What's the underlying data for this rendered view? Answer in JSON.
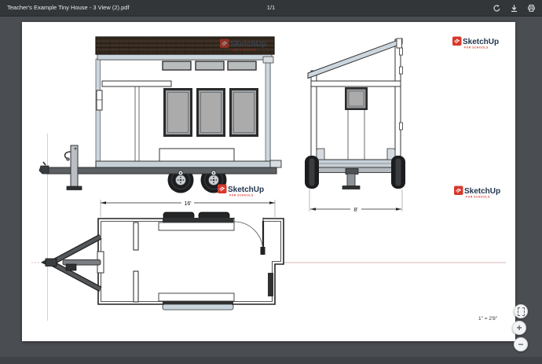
{
  "toolbar": {
    "title": "Teacher's Example Tiny House - 3 View (2).pdf",
    "page_indicator": "1/1",
    "icons": [
      "rotate-icon",
      "download-icon",
      "print-icon"
    ]
  },
  "zoom_controls": {
    "fit_icon": "fit-page-icon",
    "zoom_in": "+",
    "zoom_out": "−"
  },
  "drawing": {
    "brand_name": "SketchUp",
    "brand_tagline": "FOR SCHOOLS",
    "dim_plan_width": "16'",
    "dim_side_width": "8'",
    "scale_note": "1\" = 2'8\"",
    "colors": {
      "brand_red": "#d8382c",
      "logo_text_navy": "#22364e",
      "roof_shingle_brown": "#3a2e23",
      "window_glass_gray": "#ababab",
      "trim_blue_gray": "#ccd6de",
      "axis_green": "#c2dcba",
      "axis_red": "#d6b6b6",
      "toolbar_bg": "#323639",
      "viewer_bg": "#4a4d52"
    }
  }
}
